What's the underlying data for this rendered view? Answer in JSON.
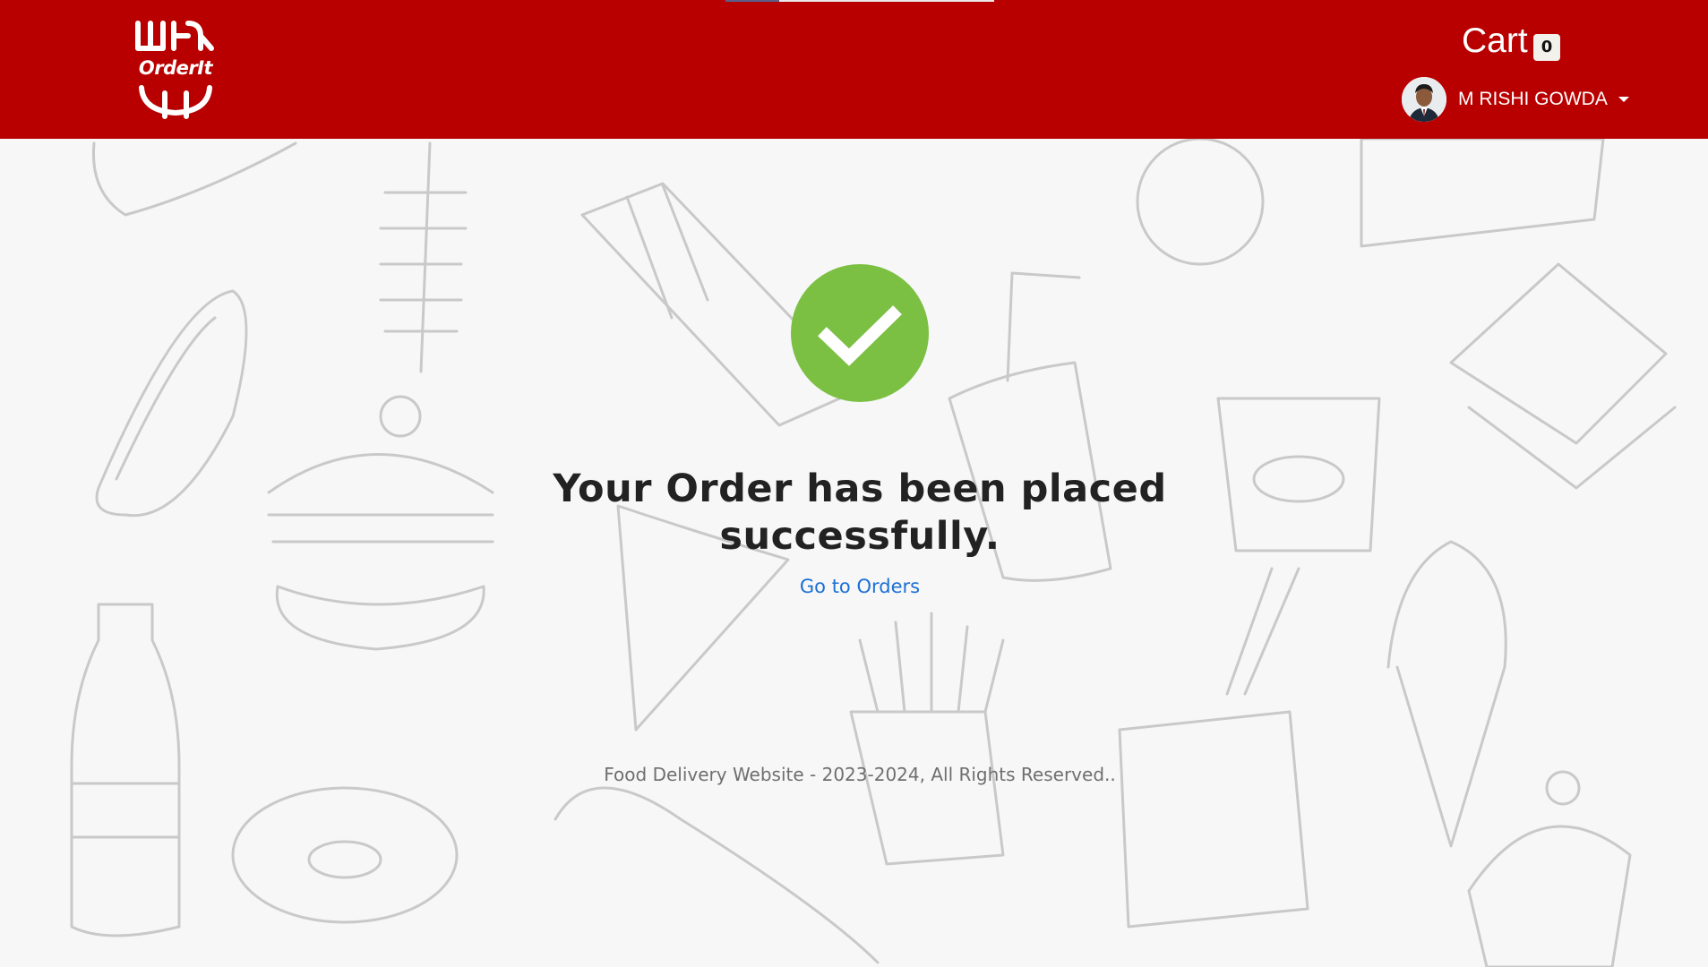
{
  "header": {
    "logo_text": "OrderIt",
    "cart_label": "Cart",
    "cart_count": "0",
    "user_name": "M RISHI GOWDA"
  },
  "main": {
    "title": "Your Order has been placed successfully.",
    "orders_link": "Go to Orders"
  },
  "footer": {
    "text": "Food Delivery Website - 2023-2024, All Rights Reserved.."
  },
  "colors": {
    "header_bg": "#b90000",
    "success_green": "#7bc043",
    "link_blue": "#1a6fd6"
  },
  "icons": [
    "orderit-logo",
    "check-circle-icon",
    "avatar",
    "caret-down-icon"
  ]
}
